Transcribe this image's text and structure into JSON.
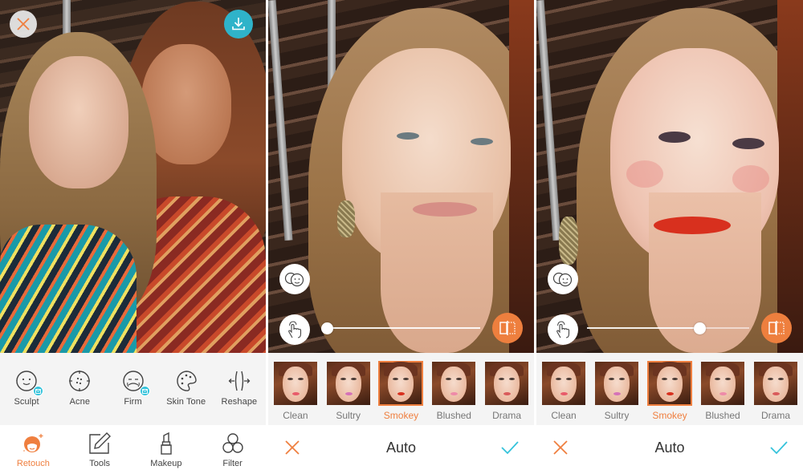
{
  "colors": {
    "accent_orange": "#ef7f3f",
    "accent_teal": "#2fb3c9",
    "confirm_blue": "#35c3db",
    "panel_gray": "#f4f4f4",
    "text_dark": "#333333",
    "text_gray": "#777777"
  },
  "screen1": {
    "top_left_button": {
      "icon": "close-icon"
    },
    "top_right_button": {
      "icon": "download-icon"
    },
    "tools": [
      {
        "label": "Sculpt",
        "icon": "sculpt-face-icon",
        "premium_badge": true
      },
      {
        "label": "Acne",
        "icon": "acne-icon",
        "premium_badge": false
      },
      {
        "label": "Firm",
        "icon": "firm-face-icon",
        "premium_badge": true
      },
      {
        "label": "Skin Tone",
        "icon": "palette-icon",
        "premium_badge": false
      },
      {
        "label": "Reshape",
        "icon": "reshape-icon",
        "premium_badge": false
      }
    ],
    "nav": [
      {
        "label": "Retouch",
        "icon": "retouch-face-icon",
        "active": true
      },
      {
        "label": "Tools",
        "icon": "edit-pencil-icon",
        "active": false
      },
      {
        "label": "Makeup",
        "icon": "lipstick-icon",
        "active": false
      },
      {
        "label": "Filter",
        "icon": "filter-circles-icon",
        "active": false
      }
    ]
  },
  "screen2": {
    "slider_value": 0.0,
    "styles": [
      {
        "label": "Clean",
        "lip": "#e85b6a",
        "selected": false
      },
      {
        "label": "Sultry",
        "lip": "#d572b8",
        "selected": false
      },
      {
        "label": "Smokey",
        "lip": "#d8301e",
        "selected": true
      },
      {
        "label": "Blushed",
        "lip": "#ee8aa8",
        "selected": false
      },
      {
        "label": "Drama",
        "lip": "#d95a5a",
        "selected": false
      }
    ],
    "mode_title": "Auto"
  },
  "screen3": {
    "slider_value": 0.71,
    "styles": [
      {
        "label": "Clean",
        "lip": "#e85b6a",
        "selected": false
      },
      {
        "label": "Sultry",
        "lip": "#d572b8",
        "selected": false
      },
      {
        "label": "Smokey",
        "lip": "#d8301e",
        "selected": true
      },
      {
        "label": "Blushed",
        "lip": "#ee8aa8",
        "selected": false
      },
      {
        "label": "Drama",
        "lip": "#d95a5a",
        "selected": false
      }
    ],
    "mode_title": "Auto"
  }
}
